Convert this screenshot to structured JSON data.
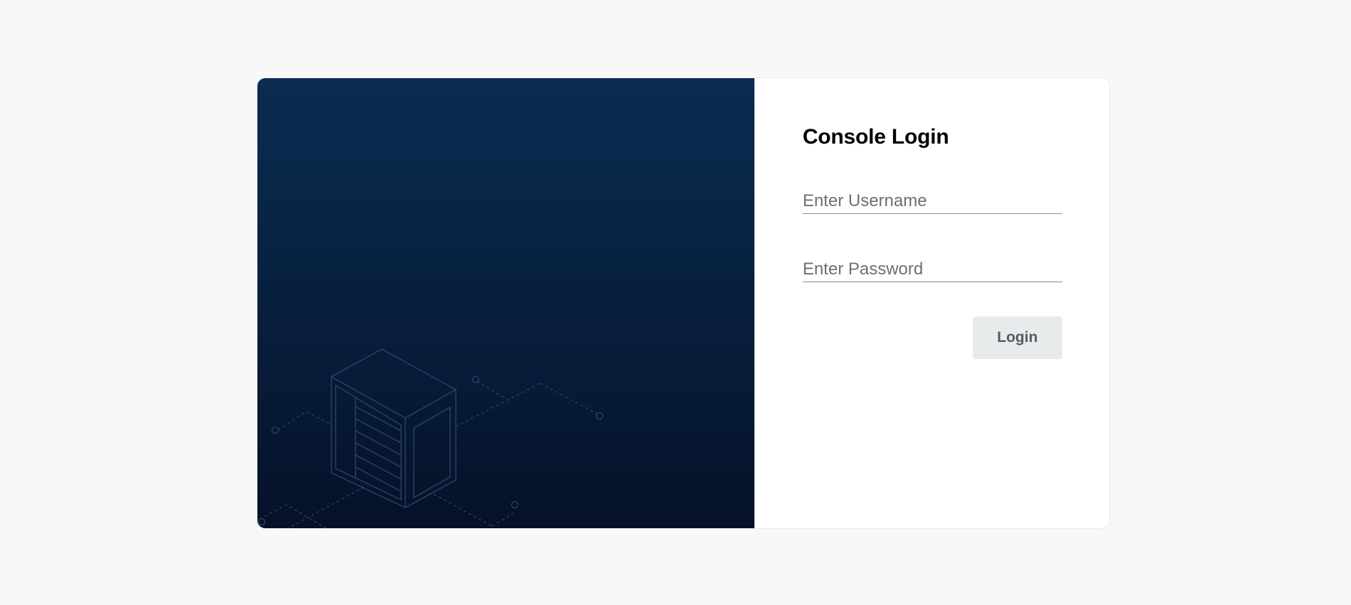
{
  "login": {
    "title": "Console Login",
    "username_placeholder": "Enter Username",
    "password_placeholder": "Enter Password",
    "login_label": "Login"
  },
  "colors": {
    "hero_gradient_top": "#0a2c51",
    "hero_gradient_bottom": "#061129",
    "page_background": "#f8f8f9",
    "button_background": "#e8ebec"
  },
  "icons": {
    "hero_illustration": "server-rack-network-illustration"
  }
}
